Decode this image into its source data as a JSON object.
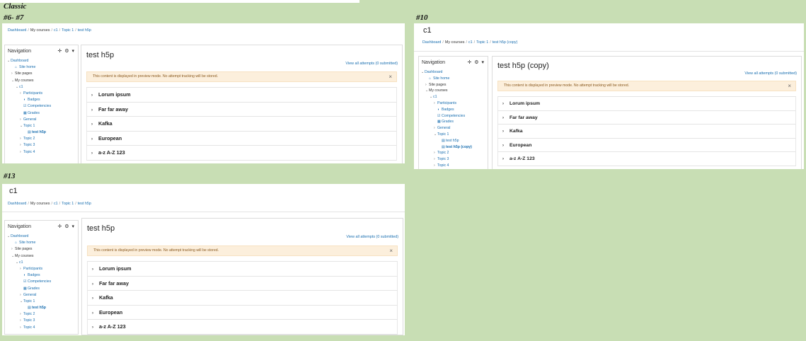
{
  "labels": {
    "classic": "Classic",
    "p1": "#6- #7",
    "p2": "#10",
    "p3": "#13"
  },
  "breadcrumb": {
    "dashboard": "Dashboard",
    "my_courses": "My courses",
    "course": "c1",
    "topic": "Topic 1",
    "activity": "test h5p",
    "activity_copy": "test h5p (copy)",
    "sep": "/"
  },
  "course_title": "c1",
  "navigation": {
    "title": "Navigation",
    "tools": "✛ ⚙ ▾",
    "items": [
      {
        "label": "Dashboard",
        "caret": "⌄",
        "icon": "",
        "type": "lnk",
        "indent": 0
      },
      {
        "label": "Site home",
        "caret": "",
        "icon": "⌂",
        "type": "lnk",
        "indent": 1
      },
      {
        "label": "Site pages",
        "caret": "›",
        "icon": "",
        "type": "plain",
        "indent": 1
      },
      {
        "label": "My courses",
        "caret": "⌄",
        "icon": "",
        "type": "plain",
        "indent": 1
      },
      {
        "label": "c1",
        "caret": "⌄",
        "icon": "",
        "type": "lnk",
        "indent": 2
      },
      {
        "label": "Participants",
        "caret": "›",
        "icon": "",
        "type": "lnk",
        "indent": 3
      },
      {
        "label": "Badges",
        "caret": "",
        "icon": "◗",
        "type": "lnk",
        "indent": 3
      },
      {
        "label": "Competencies",
        "caret": "",
        "icon": "☑",
        "type": "lnk",
        "indent": 3
      },
      {
        "label": "Grades",
        "caret": "",
        "icon": "▦",
        "type": "lnk",
        "indent": 3
      },
      {
        "label": "General",
        "caret": "›",
        "icon": "",
        "type": "lnk",
        "indent": 3
      },
      {
        "label": "Topic 1",
        "caret": "⌄",
        "icon": "",
        "type": "lnk",
        "indent": 3
      },
      {
        "label": "test h5p",
        "caret": "",
        "icon": "▤",
        "type": "cur",
        "indent": 4
      },
      {
        "label": "Topic 2",
        "caret": "›",
        "icon": "",
        "type": "lnk",
        "indent": 3
      },
      {
        "label": "Topic 3",
        "caret": "›",
        "icon": "",
        "type": "lnk",
        "indent": 3
      },
      {
        "label": "Topic 4",
        "caret": "›",
        "icon": "",
        "type": "lnk",
        "indent": 3
      }
    ],
    "items_copy": [
      {
        "label": "Dashboard",
        "caret": "⌄",
        "icon": "",
        "type": "lnk",
        "indent": 0
      },
      {
        "label": "Site home",
        "caret": "",
        "icon": "⌂",
        "type": "lnk",
        "indent": 1
      },
      {
        "label": "Site pages",
        "caret": "›",
        "icon": "",
        "type": "plain",
        "indent": 1
      },
      {
        "label": "My courses",
        "caret": "⌄",
        "icon": "",
        "type": "plain",
        "indent": 1
      },
      {
        "label": "c1",
        "caret": "⌄",
        "icon": "",
        "type": "lnk",
        "indent": 2
      },
      {
        "label": "Participants",
        "caret": "›",
        "icon": "",
        "type": "lnk",
        "indent": 3
      },
      {
        "label": "Badges",
        "caret": "",
        "icon": "◗",
        "type": "lnk",
        "indent": 3
      },
      {
        "label": "Competencies",
        "caret": "",
        "icon": "☑",
        "type": "lnk",
        "indent": 3
      },
      {
        "label": "Grades",
        "caret": "",
        "icon": "▦",
        "type": "lnk",
        "indent": 3
      },
      {
        "label": "General",
        "caret": "›",
        "icon": "",
        "type": "lnk",
        "indent": 3
      },
      {
        "label": "Topic 1",
        "caret": "⌄",
        "icon": "",
        "type": "lnk",
        "indent": 3
      },
      {
        "label": "test h5p",
        "caret": "",
        "icon": "▤",
        "type": "lnk",
        "indent": 4
      },
      {
        "label": "test h5p (copy)",
        "caret": "",
        "icon": "▤",
        "type": "cur",
        "indent": 4
      },
      {
        "label": "Topic 2",
        "caret": "›",
        "icon": "",
        "type": "lnk",
        "indent": 3
      },
      {
        "label": "Topic 3",
        "caret": "›",
        "icon": "",
        "type": "lnk",
        "indent": 3
      },
      {
        "label": "Topic 4",
        "caret": "›",
        "icon": "",
        "type": "lnk",
        "indent": 3
      }
    ]
  },
  "activity": {
    "title": "test h5p",
    "title_copy": "test h5p (copy)",
    "attempts_link": "View all attempts (0 submitted)",
    "preview_notice": "This content is displayed in preview mode. No attempt tracking will be stored.",
    "close": "×",
    "sections": [
      "Lorum ipsum",
      "Far far away",
      "Kafka",
      "European",
      "a-z A-Z 123"
    ]
  },
  "colors": {
    "link": "#1a6fb0",
    "alert_bg": "#fcefdc",
    "page_bg": "#c8deb4"
  }
}
